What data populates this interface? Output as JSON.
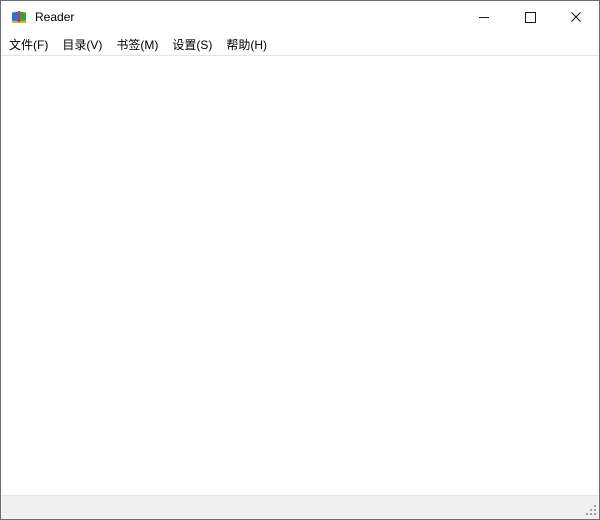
{
  "window": {
    "title": "Reader"
  },
  "titlebar": {
    "icon": "book-icon",
    "controls": [
      {
        "name": "minimize",
        "icon": "minimize-icon"
      },
      {
        "name": "maximize",
        "icon": "maximize-icon"
      },
      {
        "name": "close",
        "icon": "close-icon"
      }
    ]
  },
  "menu": {
    "items": [
      {
        "label": "文件(F)"
      },
      {
        "label": "目录(V)"
      },
      {
        "label": "书签(M)"
      },
      {
        "label": "设置(S)"
      },
      {
        "label": "帮助(H)"
      }
    ]
  },
  "statusbar": {
    "text": ""
  },
  "colors": {
    "window_border": "#6e6e6e",
    "menu_separator": "#e5e5e5",
    "statusbar_bg": "#f0f0f0",
    "control_glyph": "#1a1a1a",
    "icon_blue": "#2f6fd6",
    "icon_green": "#3aa233",
    "icon_red": "#d8382e",
    "icon_tan": "#d2b14a"
  }
}
